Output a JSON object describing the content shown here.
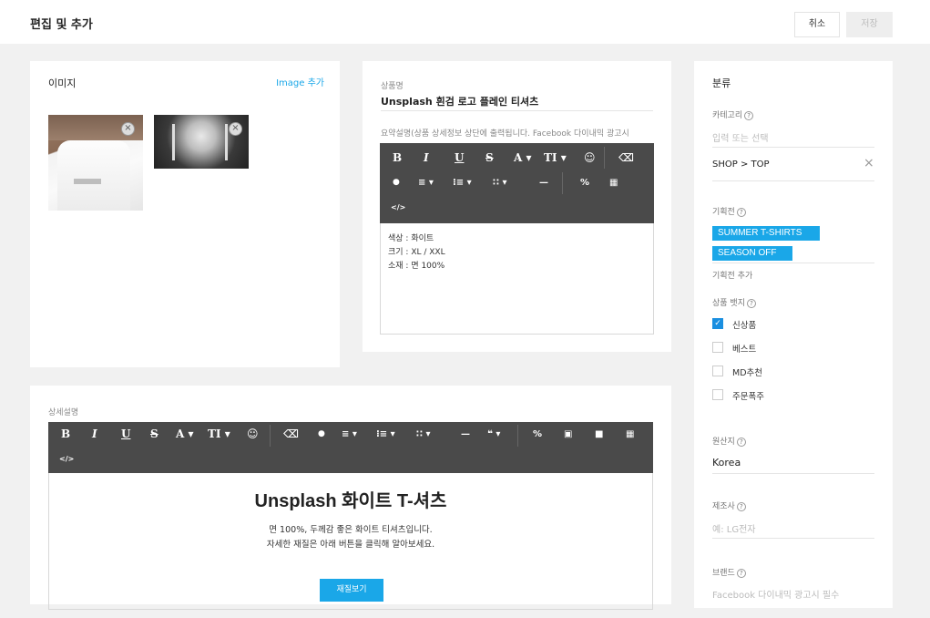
{
  "header": {
    "title": "편집 및 추가",
    "cancel": "취소",
    "save": "저장"
  },
  "images": {
    "title": "이미지",
    "add_link": "Image 추가",
    "close": "×"
  },
  "name": {
    "label": "상품명",
    "value": "Unsplash 흰검 로고 플레인 티셔츠",
    "summary_label": "요약설명(상품 상세정보 상단에 출력됩니다. Facebook 다이내믹 광고시",
    "editor_lines": [
      "색상 : 화이트",
      "크기 : XL / XXL",
      "소재 : 면 100%"
    ]
  },
  "toolbar_small": {
    "row1": [
      "B",
      "I",
      "U",
      "S",
      "A ▾",
      "TI ▾",
      "☺",
      "⌫"
    ],
    "row2": [
      "●",
      "≡ ▾",
      "⁝≡ ▾",
      "∷ ▾",
      "—",
      "%",
      "▦"
    ],
    "row3": [
      "</>"
    ]
  },
  "detail": {
    "label": "상세설명",
    "row1": [
      "B",
      "I",
      "U",
      "S",
      "A ▾",
      "TI ▾",
      "☺",
      "⌫",
      "●",
      "≡ ▾",
      "⁝≡ ▾",
      "∷ ▾",
      "—",
      "❝ ▾",
      "%",
      "▣",
      "■",
      "▦"
    ],
    "row2": [
      "</>"
    ],
    "heading": "Unsplash 화이트 T-셔츠",
    "line1": "면 100%, 두께감 좋은 화이트 티셔츠입니다.",
    "line2": "자세한 재질은 아래 버튼을 클릭해 알아보세요.",
    "button": "재질보기"
  },
  "side": {
    "title": "분류",
    "category_label": "카테고리",
    "category_placeholder": "입력 또는 선택",
    "category_value": "SHOP > TOP",
    "clear": "×",
    "promo_label": "기획전",
    "promo_tags": [
      "SUMMER T-SHIRTS",
      "SEASON OFF"
    ],
    "promo_add": "기획전 추가",
    "badge_label": "상품 뱃지",
    "badges": [
      {
        "label": "신상품",
        "checked": true
      },
      {
        "label": "베스트",
        "checked": false
      },
      {
        "label": "MD추천",
        "checked": false
      },
      {
        "label": "주문폭주",
        "checked": false
      }
    ],
    "origin_label": "원산지",
    "origin_value": "Korea",
    "maker_label": "제조사",
    "maker_placeholder": "예: LG전자",
    "brand_label": "브랜드",
    "brand_placeholder": "Facebook 다이내믹 광고시 필수",
    "help": "?"
  },
  "colors": {
    "accent": "#1aa7e8",
    "toolbar": "#4a4a4a",
    "background": "#f1f1f1"
  }
}
